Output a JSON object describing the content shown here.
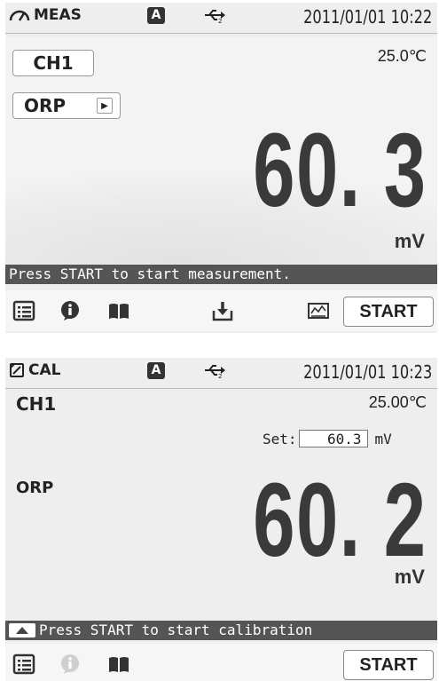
{
  "screen1": {
    "mode": "MEAS",
    "hold_badge": "A",
    "usb_icon": "usb-icon",
    "datetime": "2011/01/01 10:22",
    "temperature": "25.0℃",
    "channel_button": "CH1",
    "parameter_button": "ORP",
    "value": "60. 3",
    "unit": "mV",
    "message": "Press START to start measurement.",
    "start_label": "START"
  },
  "screen2": {
    "mode": "CAL",
    "hold_badge": "A",
    "usb_icon": "usb-icon",
    "datetime": "2011/01/01 10:23",
    "channel": "CH1",
    "temperature": "25.00℃",
    "set_label": "Set:",
    "set_value": "60.3",
    "set_unit": "mV",
    "parameter": "ORP",
    "value": "60. 2",
    "unit": "mV",
    "message": "Press START to start calibration",
    "start_label": "START"
  }
}
